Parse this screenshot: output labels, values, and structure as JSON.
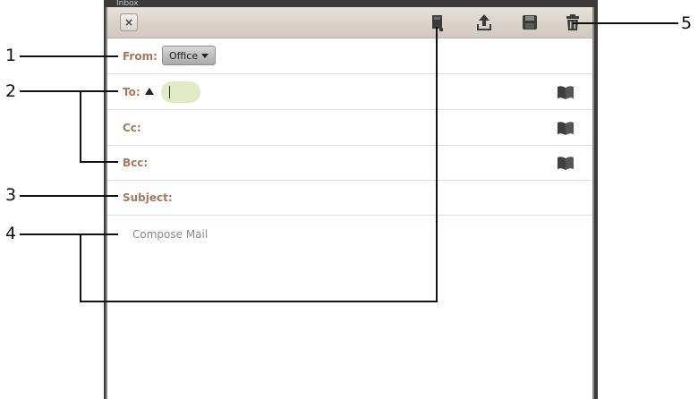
{
  "behind_label": "Inbox",
  "toolbar": {
    "close_label": "×",
    "icons": [
      "attachment-icon",
      "send-icon",
      "save-draft-icon",
      "trash-icon"
    ]
  },
  "from": {
    "label": "From:",
    "account": "Office"
  },
  "to": {
    "label": "To:",
    "value": ""
  },
  "cc": {
    "label": "Cc:"
  },
  "bcc": {
    "label": "Bcc:"
  },
  "subject": {
    "label": "Subject:"
  },
  "body": {
    "placeholder": "Compose Mail"
  },
  "callouts": [
    "1",
    "2",
    "3",
    "4",
    "5"
  ],
  "colors": {
    "label": "#a7785d",
    "row_divider": "#f2d8dc",
    "to_chip": "#e0ebc6",
    "toolbar": "#d9d3ca"
  }
}
